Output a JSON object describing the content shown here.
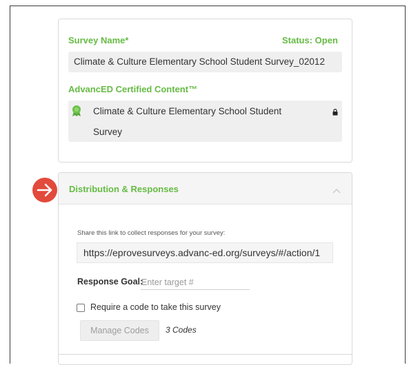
{
  "survey": {
    "name_label": "Survey Name*",
    "status_text": "Status: Open",
    "name_value": "Climate & Culture Elementary School Student Survey_02012",
    "certified_label": "AdvancED Certified Content™",
    "certified_line1": "Climate & Culture Elementary School Student",
    "certified_line2": "Survey",
    "certified_icon": "ribbon-badge-icon",
    "lock_icon": "lock-icon"
  },
  "distribution": {
    "title": "Distribution & Responses",
    "collapse_icon": "chevron-up-icon",
    "pointer_icon": "arrow-right-circle-icon",
    "share_text": "Share this link to collect responses for your survey:",
    "share_url": "https://eprovesurveys.advanc-ed.org/surveys/#/action/1",
    "goal_label": "Response Goal:",
    "goal_placeholder": "Enter target #",
    "goal_value": "",
    "require_code_label": "Require a code to take this survey",
    "require_code_checked": false,
    "manage_codes_label": "Manage Codes",
    "codes_count": "3 Codes"
  },
  "colors": {
    "accent_green": "#66bb44",
    "badge_red": "#e24a3b",
    "field_gray": "#efefef"
  }
}
